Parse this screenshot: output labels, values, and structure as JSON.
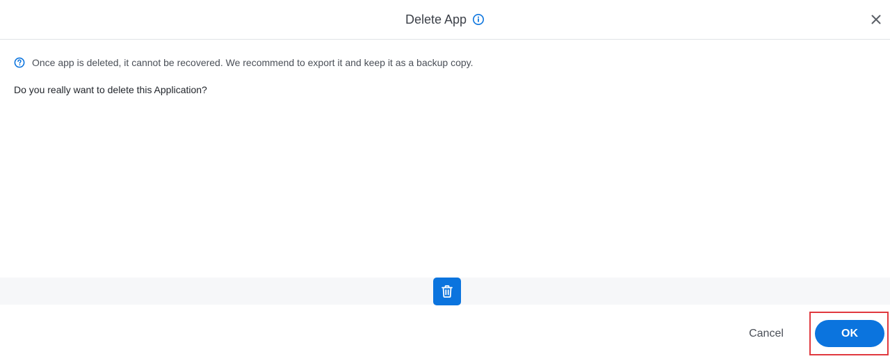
{
  "dialog": {
    "title": "Delete App",
    "info_icon": "info-icon",
    "close_icon": "close-icon"
  },
  "body": {
    "notice_icon": "help-circle-icon",
    "notice_text": "Once app is deleted, it cannot be recovered. We recommend to export it and keep it as a backup copy.",
    "question": "Do you really want to delete this Application?"
  },
  "band": {
    "trash_icon": "trash-icon"
  },
  "footer": {
    "cancel_label": "Cancel",
    "ok_label": "OK"
  },
  "colors": {
    "accent": "#0b74de",
    "highlight": "#e0383e",
    "band_bg": "#f6f7f9"
  }
}
